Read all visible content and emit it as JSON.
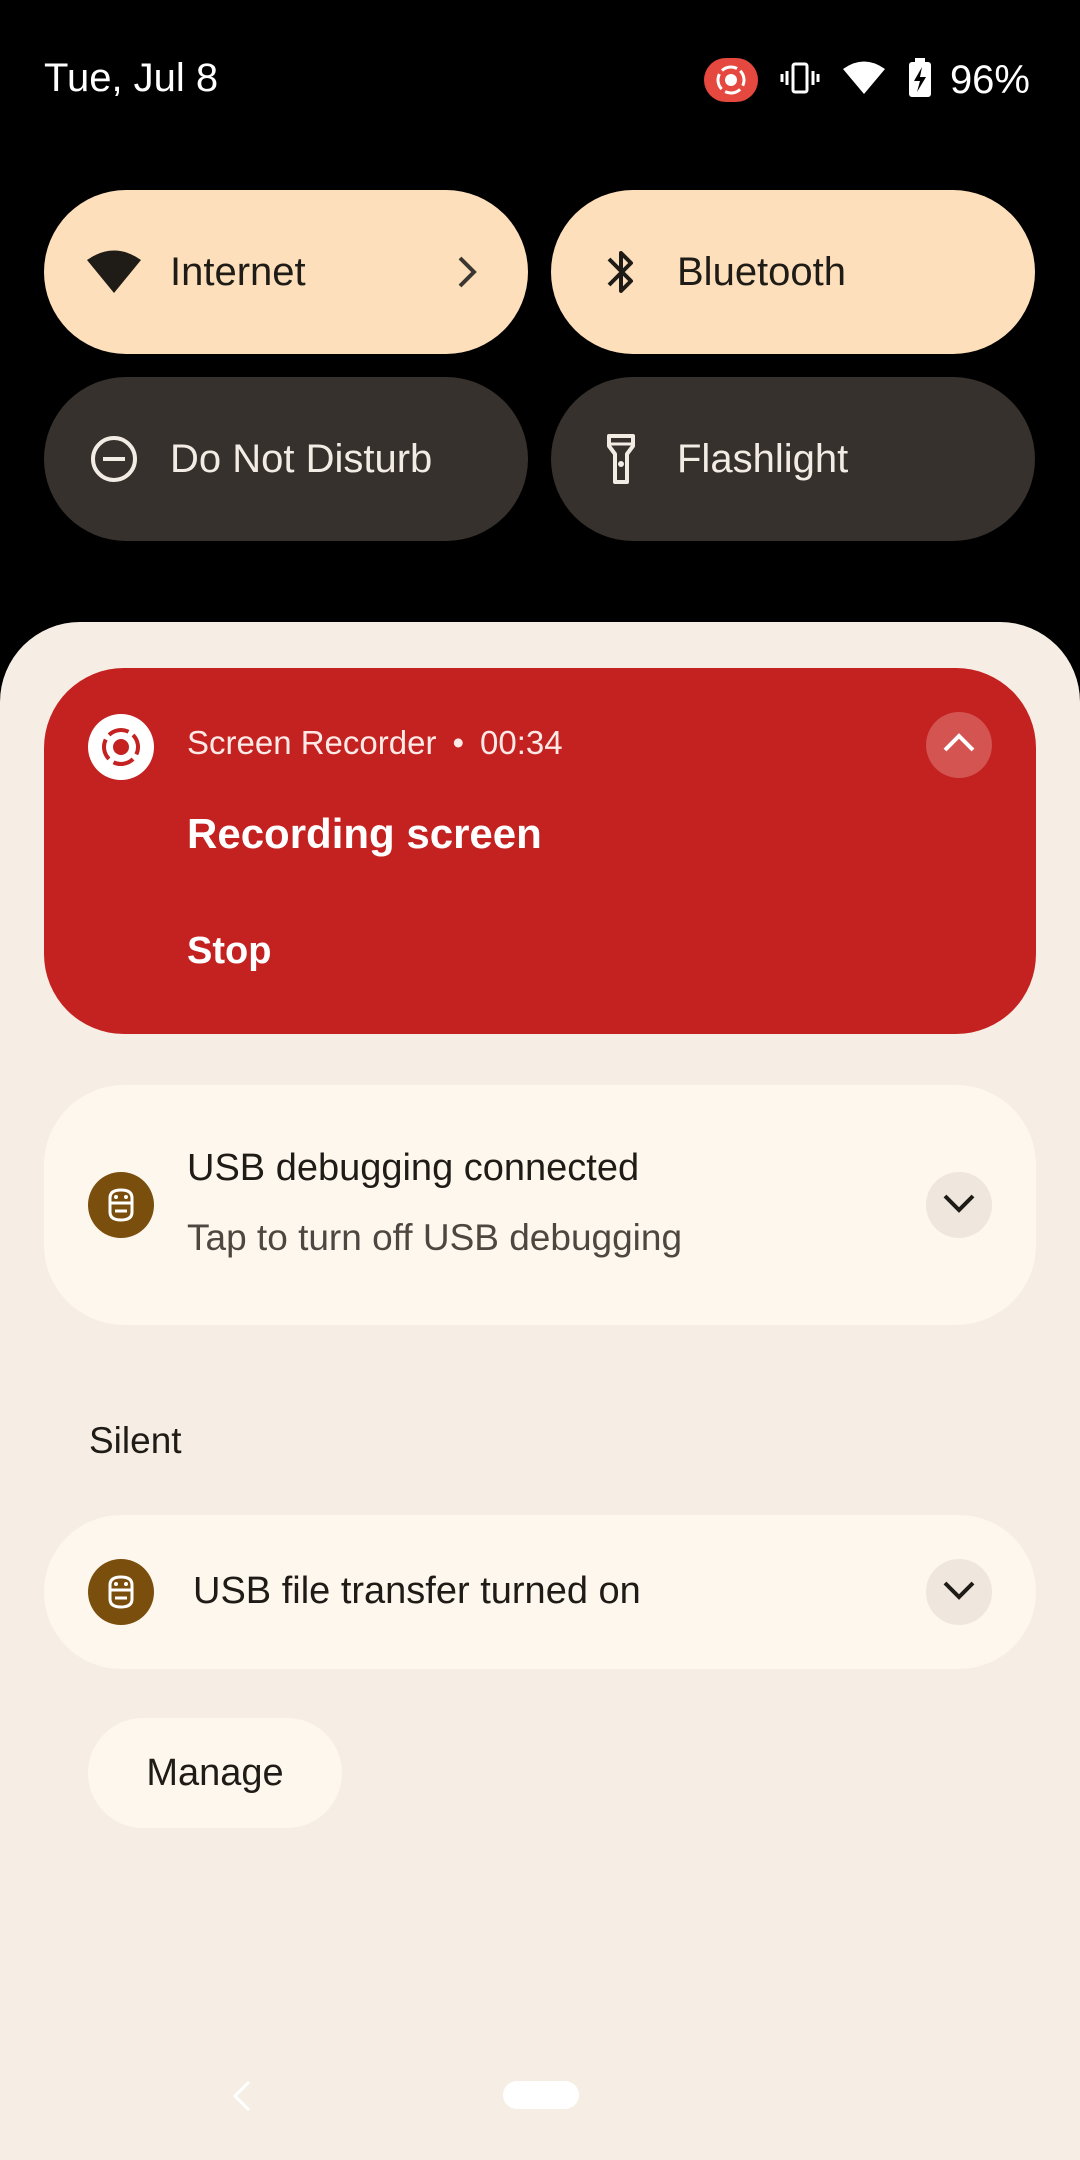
{
  "status_bar": {
    "date": "Tue, Jul 8",
    "battery_percent": "96%",
    "icons": [
      "screen-record-icon",
      "vibrate-icon",
      "wifi-icon",
      "battery-charging-icon"
    ]
  },
  "quick_settings": {
    "tiles": [
      {
        "label": "Internet",
        "icon": "wifi-icon",
        "state": "on",
        "has_chevron": true
      },
      {
        "label": "Bluetooth",
        "icon": "bluetooth-icon",
        "state": "on"
      },
      {
        "label": "Do Not Disturb",
        "icon": "do-not-disturb-icon",
        "state": "off"
      },
      {
        "label": "Flashlight",
        "icon": "flashlight-icon",
        "state": "off"
      }
    ]
  },
  "notifications": {
    "recording": {
      "app_name": "Screen Recorder",
      "separator": "•",
      "elapsed": "00:34",
      "title": "Recording screen",
      "action": "Stop",
      "color": "#c42121"
    },
    "usb_debugging": {
      "title": "USB debugging connected",
      "text": "Tap to turn off USB debugging"
    },
    "silent_section_label": "Silent",
    "usb_file_transfer": {
      "title": "USB file transfer turned on"
    }
  },
  "manage_button_label": "Manage",
  "colors": {
    "tile_on": "#fde0bb",
    "tile_off": "#36312c",
    "shade_bg": "#f6eee4",
    "card_bg": "#fef7ee",
    "android_icon_bg": "#7a4e0d"
  }
}
